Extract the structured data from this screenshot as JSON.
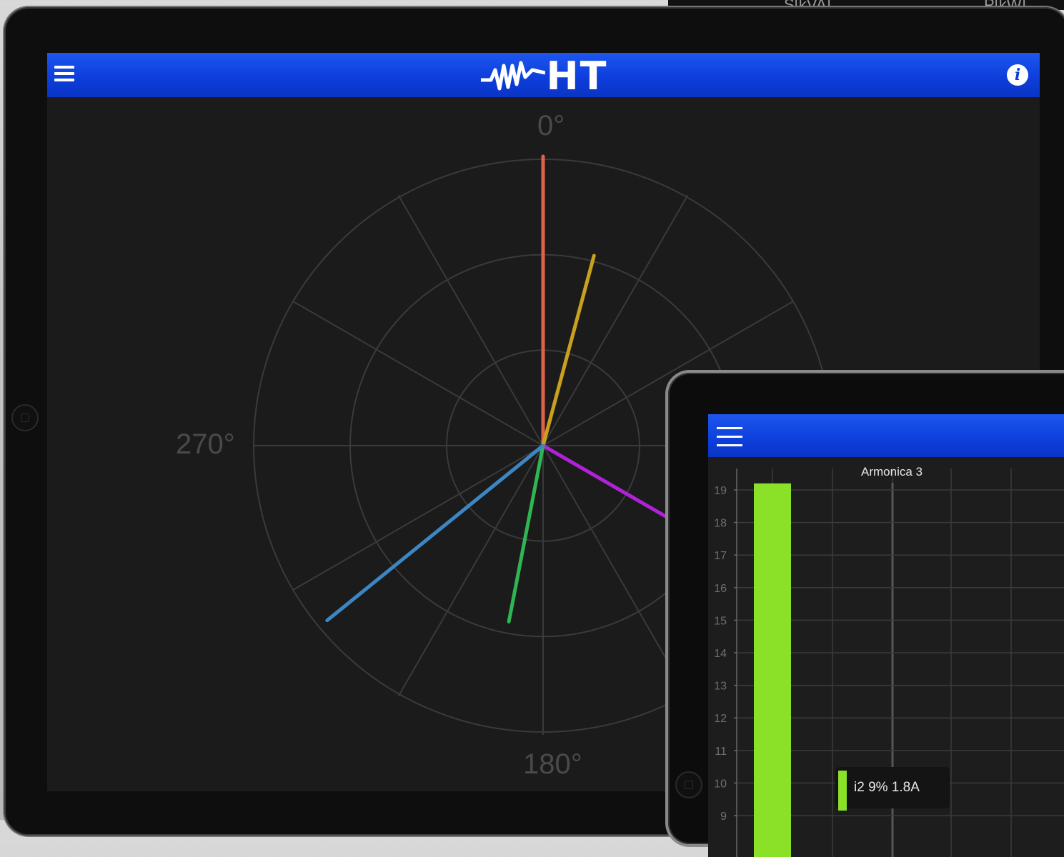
{
  "background_device": {
    "header_cells": [
      "S[kVA]",
      "P[kW]"
    ]
  },
  "main_app": {
    "brand": "HT",
    "colors": {
      "appbar": "#0d3fdc",
      "grid": "#3a3a3a",
      "background": "#1b1b1c"
    },
    "icons": {
      "menu": "hamburger-icon",
      "info": "info-icon",
      "logo": "ht-logo"
    },
    "polar": {
      "labels": {
        "top": "0°",
        "left": "270°",
        "bottom": "180°"
      },
      "rings": 3,
      "vectors": [
        {
          "color": "#e0614a",
          "angle_deg": 0,
          "magnitude": 1.0
        },
        {
          "color": "#c9a11f",
          "angle_deg": 15,
          "magnitude": 0.68
        },
        {
          "color": "#b022d8",
          "angle_deg": 120,
          "magnitude": 0.78
        },
        {
          "color": "#2fb553",
          "angle_deg": 191,
          "magnitude": 0.62
        },
        {
          "color": "#3d86c4",
          "angle_deg": 231,
          "magnitude": 0.96
        }
      ]
    }
  },
  "second_app": {
    "icons": {
      "menu": "hamburger-icon"
    },
    "chart_data": {
      "type": "bar",
      "title": "Armonica 3",
      "y_ticks": [
        9,
        10,
        11,
        12,
        13,
        14,
        15,
        16,
        17,
        18,
        19
      ],
      "ylim": [
        9,
        19.5
      ],
      "series": [
        {
          "name": "i2",
          "color": "#8be028",
          "values": [
            19.2
          ]
        }
      ],
      "tooltip": "i2 9% 1.8A"
    }
  }
}
